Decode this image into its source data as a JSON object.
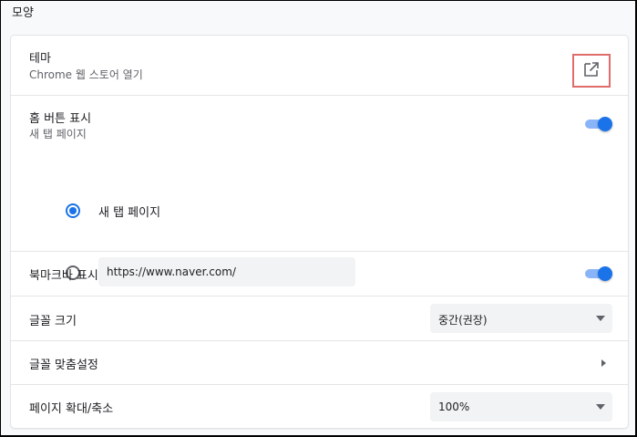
{
  "section": {
    "title": "모양"
  },
  "theme": {
    "label": "테마",
    "sublabel": "Chrome 웹 스토어 열기",
    "action_icon": "open-in-new-icon"
  },
  "home_button": {
    "label": "홈 버튼 표시",
    "sublabel": "새 탭 페이지",
    "enabled": true,
    "options": [
      {
        "label": "새 탭 페이지",
        "selected": true
      },
      {
        "value": "https://www.naver.com/",
        "selected": false
      }
    ]
  },
  "bookmarks_bar": {
    "label": "북마크바 표시",
    "enabled": true
  },
  "font_size": {
    "label": "글꼴 크기",
    "selected": "중간(권장)"
  },
  "font_customize": {
    "label": "글꼴 맞춤설정"
  },
  "page_zoom": {
    "label": "페이지 확대/축소",
    "selected": "100%"
  },
  "colors": {
    "accent": "#1a73e8",
    "toggle_track": "#8ab4f8",
    "highlight_box": "#e06c6c"
  }
}
